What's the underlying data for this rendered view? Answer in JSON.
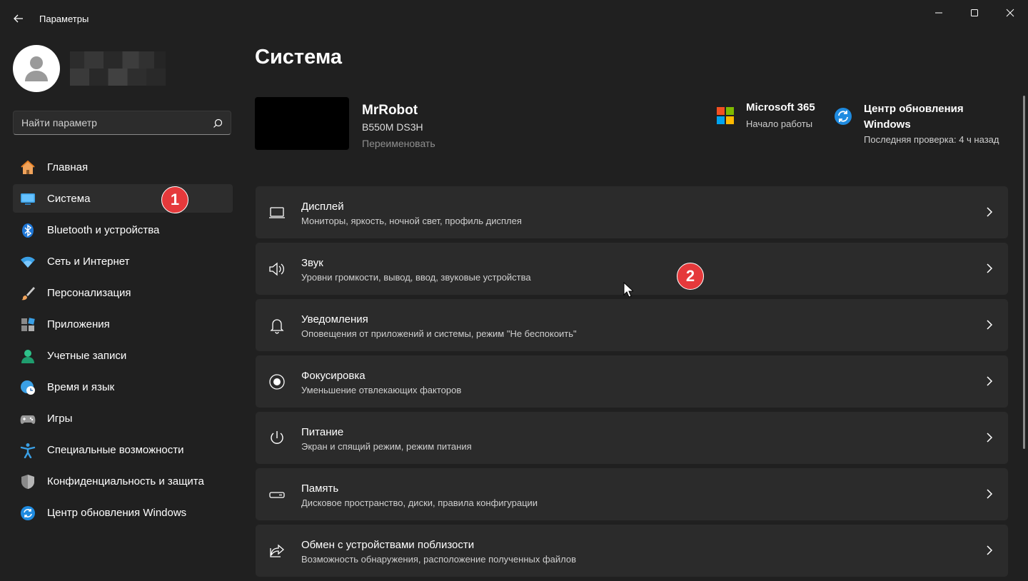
{
  "window": {
    "title": "Параметры"
  },
  "search": {
    "placeholder": "Найти параметр"
  },
  "sidebar": {
    "items": [
      {
        "label": "Главная",
        "icon": "home-icon"
      },
      {
        "label": "Система",
        "icon": "monitor-icon",
        "active": true
      },
      {
        "label": "Bluetooth и устройства",
        "icon": "bluetooth-icon"
      },
      {
        "label": "Сеть и Интернет",
        "icon": "wifi-icon"
      },
      {
        "label": "Персонализация",
        "icon": "brush-icon"
      },
      {
        "label": "Приложения",
        "icon": "apps-icon"
      },
      {
        "label": "Учетные записи",
        "icon": "account-icon"
      },
      {
        "label": "Время и язык",
        "icon": "globe-clock-icon"
      },
      {
        "label": "Игры",
        "icon": "gamepad-icon"
      },
      {
        "label": "Специальные возможности",
        "icon": "accessibility-icon"
      },
      {
        "label": "Конфиденциальность и защита",
        "icon": "shield-icon"
      },
      {
        "label": "Центр обновления Windows",
        "icon": "update-icon"
      }
    ]
  },
  "badges": {
    "first": "1",
    "second": "2"
  },
  "main": {
    "title": "Система",
    "device": {
      "name": "MrRobot",
      "model": "B550M DS3H",
      "rename": "Переименовать"
    },
    "ms365": {
      "title": "Microsoft 365",
      "subtitle": "Начало работы"
    },
    "windows_update": {
      "title": "Центр обновления Windows",
      "subtitle": "Последняя проверка: 4 ч назад"
    },
    "cards": [
      {
        "title": "Дисплей",
        "subtitle": "Мониторы, яркость, ночной свет, профиль дисплея",
        "icon": "display-icon"
      },
      {
        "title": "Звук",
        "subtitle": "Уровни громкости, вывод, ввод, звуковые устройства",
        "icon": "speaker-icon"
      },
      {
        "title": "Уведомления",
        "subtitle": "Оповещения от приложений и системы, режим \"Не беспокоить\"",
        "icon": "bell-icon"
      },
      {
        "title": "Фокусировка",
        "subtitle": "Уменьшение отвлекающих факторов",
        "icon": "focus-icon"
      },
      {
        "title": "Питание",
        "subtitle": "Экран и спящий режим, режим питания",
        "icon": "power-icon"
      },
      {
        "title": "Память",
        "subtitle": "Дисковое пространство, диски, правила конфигурации",
        "icon": "storage-icon"
      },
      {
        "title": "Обмен с устройствами поблизости",
        "subtitle": "Возможность обнаружения, расположение полученных файлов",
        "icon": "share-icon"
      }
    ]
  },
  "colors": {
    "background": "#202020",
    "card": "#2b2b2b",
    "accent": "#0078d4",
    "badge": "#e5393b"
  }
}
